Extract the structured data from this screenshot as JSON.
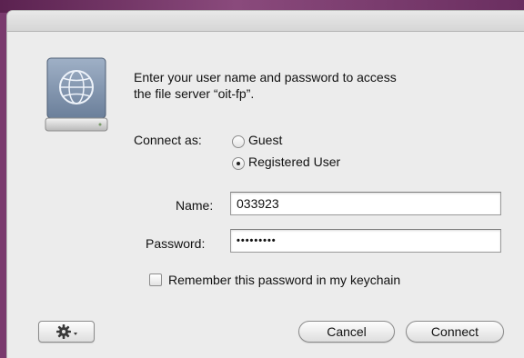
{
  "dialog": {
    "prompt_line1": "Enter your user name and password to access",
    "prompt_line2": "the file server “oit-fp”."
  },
  "connect_as": {
    "label": "Connect as:",
    "options": [
      {
        "label": "Guest",
        "selected": false
      },
      {
        "label": "Registered User",
        "selected": true
      }
    ]
  },
  "fields": {
    "name_label": "Name:",
    "name_value": "033923",
    "password_label": "Password:",
    "password_value": "•••••••••"
  },
  "keychain": {
    "label": "Remember this password in my keychain",
    "checked": false
  },
  "buttons": {
    "action_icon": "gear-icon",
    "cancel_label": "Cancel",
    "connect_label": "Connect"
  },
  "colors": {
    "dialog_background": "#ececec",
    "desktop": "#7a3a6e"
  }
}
